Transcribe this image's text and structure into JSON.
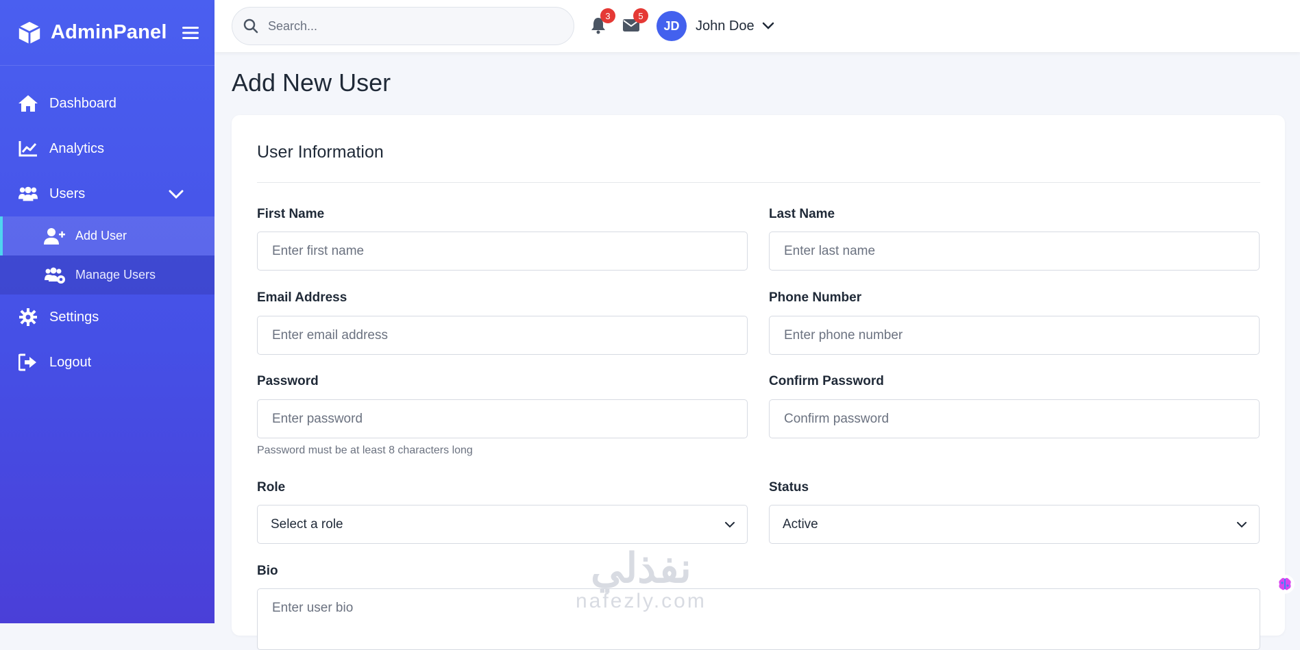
{
  "brand": {
    "name": "AdminPanel"
  },
  "sidebar": {
    "items": [
      {
        "label": "Dashboard",
        "icon": "home-icon"
      },
      {
        "label": "Analytics",
        "icon": "chart-line-icon"
      },
      {
        "label": "Users",
        "icon": "users-icon",
        "expanded": true
      },
      {
        "label": "Settings",
        "icon": "gear-icon"
      },
      {
        "label": "Logout",
        "icon": "sign-out-icon"
      }
    ],
    "users_sub": [
      {
        "label": "Add User",
        "icon": "user-plus-icon",
        "active": true
      },
      {
        "label": "Manage Users",
        "icon": "users-cog-icon",
        "active": false
      }
    ]
  },
  "topbar": {
    "search_placeholder": "Search...",
    "notifications_count": "3",
    "messages_count": "5",
    "avatar_initials": "JD",
    "user_name": "John Doe"
  },
  "page": {
    "title": "Add New User",
    "section_title": "User Information"
  },
  "form": {
    "first_name": {
      "label": "First Name",
      "placeholder": "Enter first name"
    },
    "last_name": {
      "label": "Last Name",
      "placeholder": "Enter last name"
    },
    "email": {
      "label": "Email Address",
      "placeholder": "Enter email address"
    },
    "phone": {
      "label": "Phone Number",
      "placeholder": "Enter phone number"
    },
    "password": {
      "label": "Password",
      "placeholder": "Enter password",
      "help": "Password must be at least 8 characters long"
    },
    "confirm_password": {
      "label": "Confirm Password",
      "placeholder": "Confirm password"
    },
    "role": {
      "label": "Role",
      "value": "Select a role"
    },
    "status": {
      "label": "Status",
      "value": "Active"
    },
    "bio": {
      "label": "Bio",
      "placeholder": "Enter user bio"
    }
  },
  "watermark": {
    "arabic": "نفذلي",
    "latin": "nafezly.com"
  },
  "colors": {
    "sidebar_start": "#4a5ff0",
    "sidebar_end": "#4a3fd8",
    "accent": "#4361ee",
    "badge": "#e53935",
    "active_indicator": "#4fd4f0"
  }
}
